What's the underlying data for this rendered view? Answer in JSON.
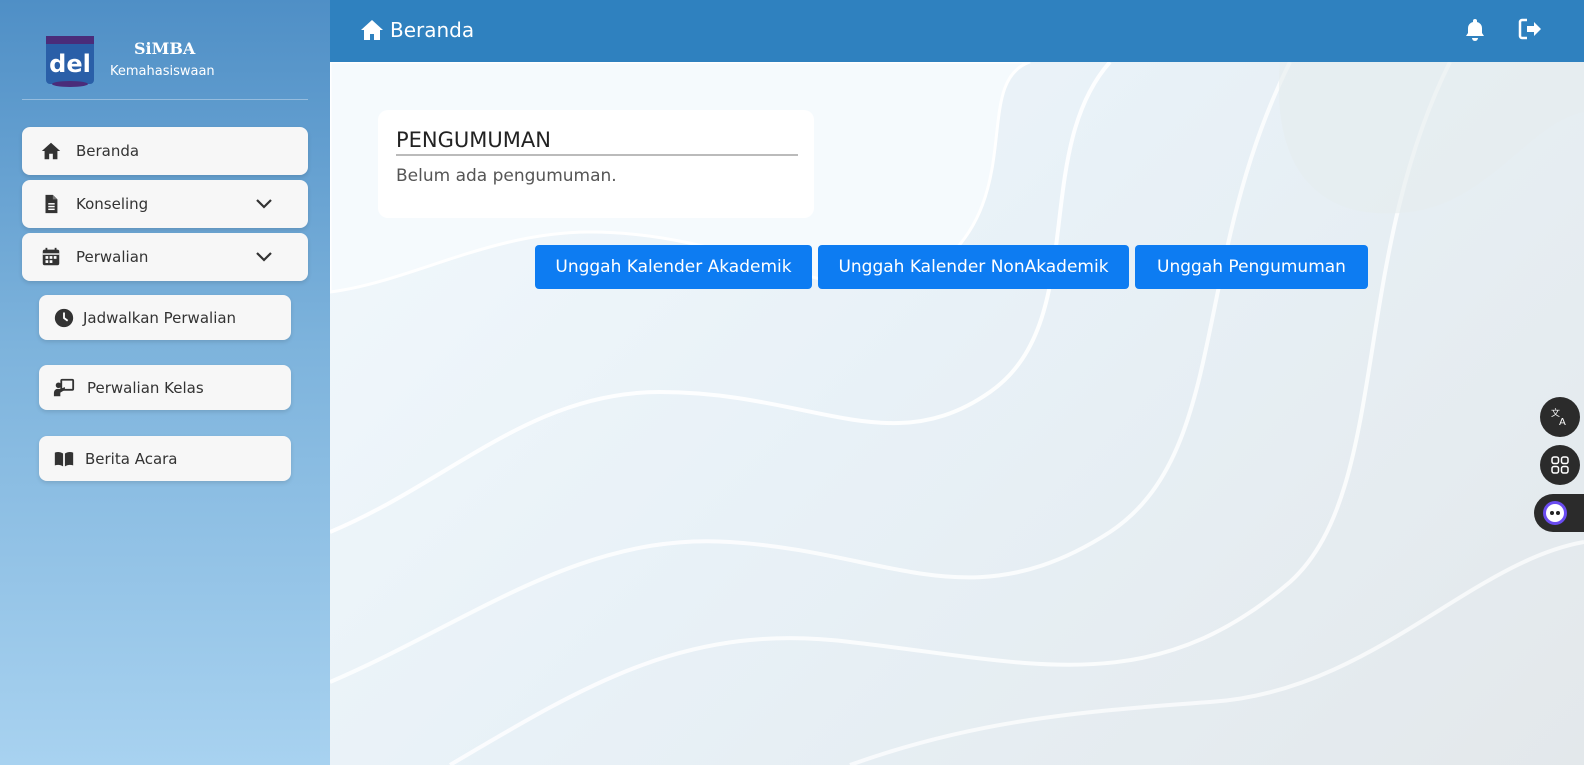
{
  "brand": {
    "title": "SiMBA",
    "subtitle": "Kemahasiswaan",
    "logo_text": "del"
  },
  "sidebar": {
    "items": [
      {
        "label": "Beranda",
        "icon": "home-icon"
      },
      {
        "label": "Konseling",
        "icon": "document-icon",
        "expandable": true
      },
      {
        "label": "Perwalian",
        "icon": "calendar-icon",
        "expandable": true
      }
    ],
    "subitems": [
      {
        "label": "Jadwalkan Perwalian",
        "icon": "clock-icon"
      },
      {
        "label": "Perwalian Kelas",
        "icon": "presentation-icon"
      },
      {
        "label": "Berita Acara",
        "icon": "book-icon"
      }
    ]
  },
  "header": {
    "title": "Beranda"
  },
  "announcement": {
    "title": "PENGUMUMAN",
    "text": "Belum ada pengumuman."
  },
  "actions": [
    {
      "label": "Unggah Kalender Akademik"
    },
    {
      "label": "Unggah Kalender NonAkademik"
    },
    {
      "label": "Unggah Pengumuman"
    }
  ],
  "colors": {
    "topbar": "#2f81bf",
    "primary_button": "#0d7cf2",
    "sidebar_top": "#4f8fc6",
    "sidebar_bottom": "#a8d2f0"
  }
}
